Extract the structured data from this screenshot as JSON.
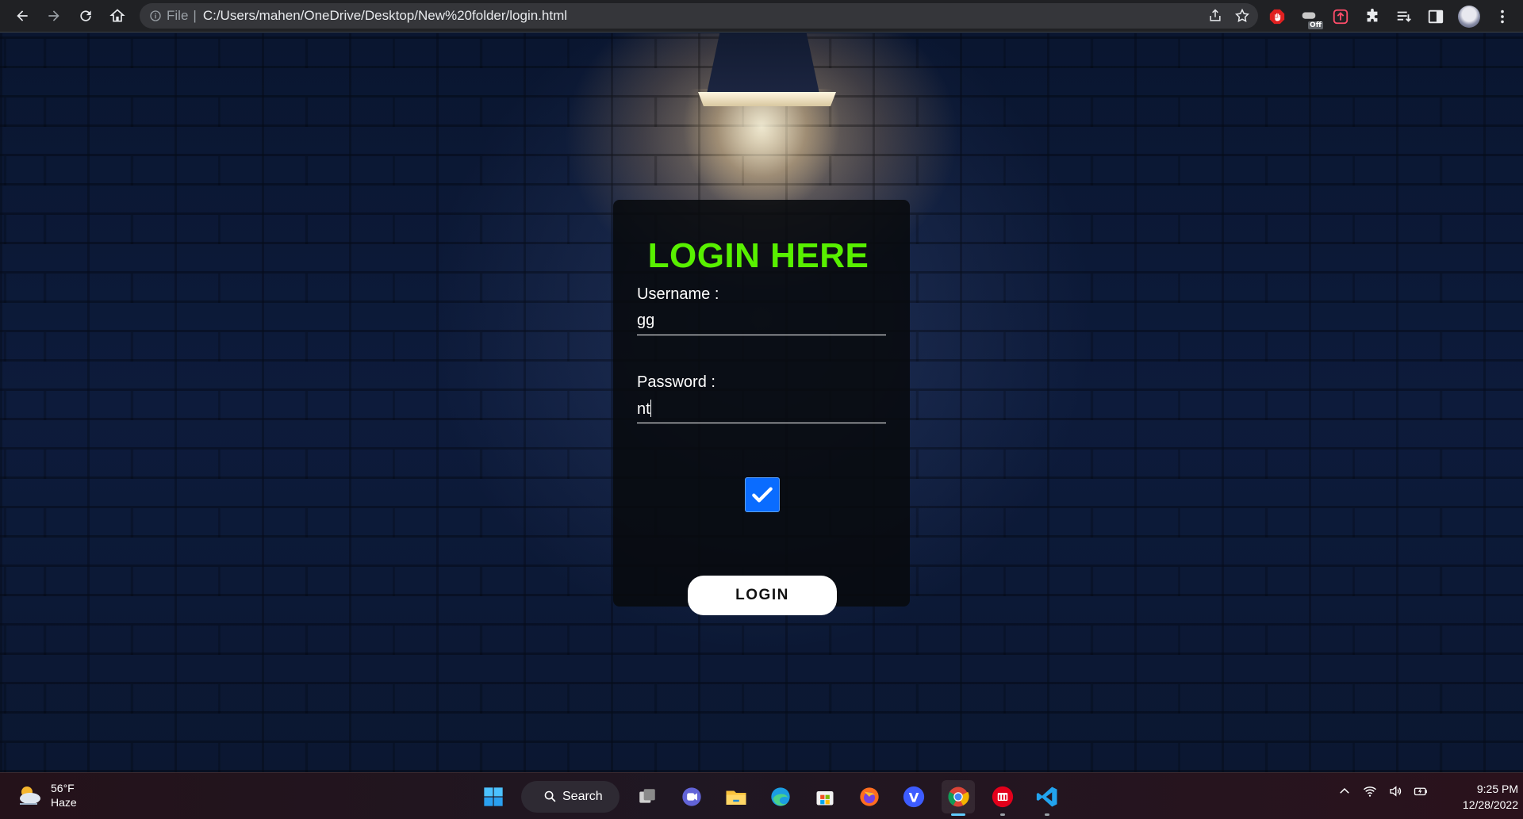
{
  "browser": {
    "omnibox": {
      "scheme_label": "File",
      "url": "C:/Users/mahen/OneDrive/Desktop/New%20folder/login.html"
    },
    "extensions": [
      {
        "name": "adblock-icon"
      },
      {
        "name": "off-toggle-icon",
        "badge": "Off"
      },
      {
        "name": "upload-icon"
      },
      {
        "name": "puzzle-icon"
      },
      {
        "name": "reading-list-icon"
      },
      {
        "name": "sidepanel-icon"
      },
      {
        "name": "avatar"
      },
      {
        "name": "kebab-menu-icon"
      }
    ]
  },
  "login": {
    "title": "LOGIN HERE",
    "username_label": "Username :",
    "username_value": "gg",
    "password_label": "Password :",
    "password_value": "nt",
    "checkbox_checked": true,
    "button_label": "LOGIN"
  },
  "taskbar": {
    "weather": {
      "temp": "56°F",
      "condition": "Haze"
    },
    "search_label": "Search",
    "apps": [
      "windows-start-icon",
      "search",
      "task-view-icon",
      "teams-chat-icon",
      "file-explorer-icon",
      "edge-icon",
      "store-icon",
      "firefox-icon",
      "viber-icon",
      "chrome-icon",
      "mail-app-icon",
      "vscode-icon"
    ],
    "active_app": "chrome-icon",
    "clock": {
      "time": "9:25 PM",
      "date": "12/28/2022"
    }
  },
  "colors": {
    "title_green": "#58f000",
    "checkbox_blue": "#0a6cff",
    "browser_bg": "#202124"
  }
}
